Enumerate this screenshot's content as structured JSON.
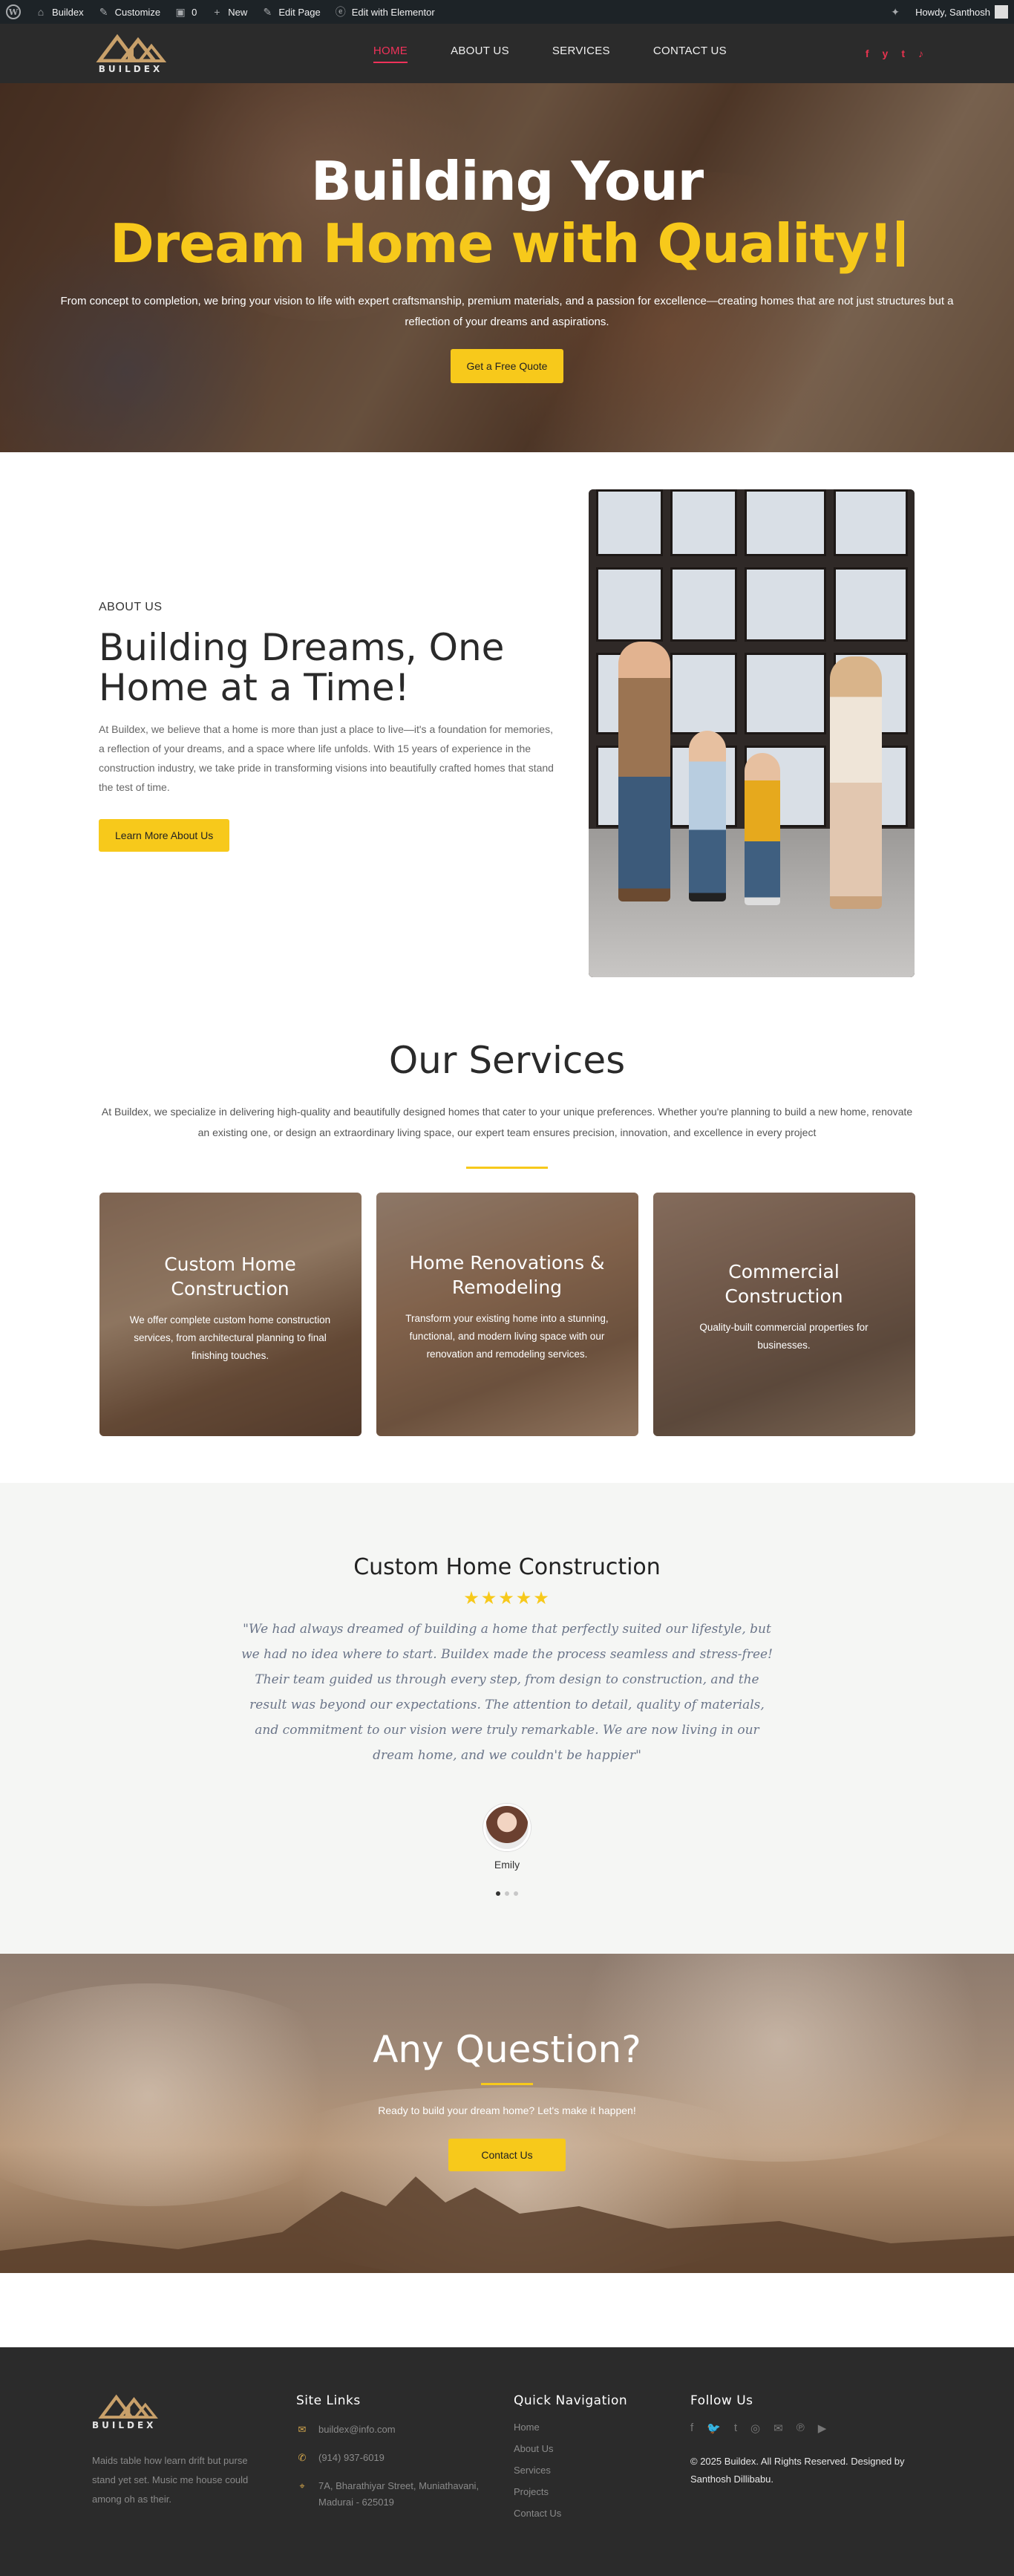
{
  "adminbar": {
    "site_name": "Buildex",
    "customize": "Customize",
    "comments": "0",
    "new": "New",
    "edit_page": "Edit Page",
    "elementor": "Edit with Elementor",
    "howdy": "Howdy, Santhosh"
  },
  "header": {
    "logo_text": "BUILDEX",
    "nav": [
      {
        "label": "HOME",
        "active": true
      },
      {
        "label": "ABOUT US"
      },
      {
        "label": "SERVICES"
      },
      {
        "label": "CONTACT US"
      }
    ],
    "socials": [
      {
        "icon": "facebook-icon",
        "glyph": "f"
      },
      {
        "icon": "twitter-icon",
        "glyph": "y"
      },
      {
        "icon": "tumblr-icon",
        "glyph": "t"
      },
      {
        "icon": "tiktok-icon",
        "glyph": "♪"
      }
    ],
    "accent_color": "#f0325a"
  },
  "hero": {
    "title_line1": "Building Your",
    "title_line2": "Dream Home with Quality!",
    "subtitle": "From concept to completion, we bring your vision to life with expert craftsmanship, premium materials, and a passion for excellence—creating homes that are not just structures but a reflection of your dreams and aspirations.",
    "cta": "Get a Free Quote",
    "accent_color": "#f7c91b"
  },
  "about": {
    "eyebrow": "ABOUT US",
    "title": "Building Dreams, One Home at a Time!",
    "body": "At Buildex, we believe that a home is more than just a place to live—it's a foundation for memories, a reflection of your dreams, and a space where life unfolds. With 15 years of experience in the construction industry, we take pride in transforming visions into beautifully crafted homes that stand the test of time.",
    "cta": "Learn More About Us"
  },
  "services": {
    "title": "Our Services",
    "intro": "At Buildex, we specialize in delivering high-quality and beautifully designed homes that cater to your unique preferences. Whether you're planning to build a new home, renovate an existing one, or design an extraordinary living space, our expert team ensures precision, innovation, and excellence in every project",
    "cards": [
      {
        "title": "Custom Home Construction",
        "text": "We offer complete custom home construction services, from architectural planning to final finishing touches."
      },
      {
        "title": "Home Renovations & Remodeling",
        "text": "Transform your existing home into a stunning, functional, and modern living space with our renovation and remodeling services."
      },
      {
        "title": "Commercial Construction",
        "text": "Quality-built commercial properties for businesses."
      }
    ]
  },
  "testimonial": {
    "title": "Custom Home Construction",
    "rating": "★★★★★",
    "rating_value": 4.5,
    "quote": "\"We had always dreamed of building a home that perfectly suited our lifestyle, but we had no idea where to start. Buildex made the process seamless and stress-free! Their team guided us through every step, from design to construction, and the result was beyond our expectations. The attention to detail, quality of materials, and commitment to our vision were truly remarkable. We are now living in our dream home, and we couldn't be happier\"",
    "name": "Emily",
    "slides": 3,
    "active_slide": 1
  },
  "cta": {
    "title": "Any Question?",
    "text": "Ready to build your dream home? Let's make it happen!",
    "button": "Contact Us"
  },
  "footer": {
    "logo_text": "BUILDEX",
    "about": "Maids table how learn drift but purse stand yet set. Music me house could among oh as their.",
    "site_links_title": "Site Links",
    "site_links": [
      {
        "icon": "envelope-icon",
        "glyph": "✉",
        "text": "buildex@info.com"
      },
      {
        "icon": "phone-icon",
        "glyph": "✆",
        "text": "(914) 937-6019"
      },
      {
        "icon": "map-pin-icon",
        "glyph": "⌖",
        "text": "7A, Bharathiyar Street, Muniathavani, Madurai - 625019"
      }
    ],
    "quick_nav_title": "Quick Navigation",
    "quick_nav": [
      "Home",
      "About Us",
      "Services",
      "Projects",
      "Contact Us"
    ],
    "follow_title": "Follow Us",
    "follow_icons": [
      {
        "icon": "facebook-icon",
        "glyph": "f"
      },
      {
        "icon": "twitter-icon",
        "glyph": "🐦"
      },
      {
        "icon": "tumblr-icon",
        "glyph": "t"
      },
      {
        "icon": "instagram-icon",
        "glyph": "◎"
      },
      {
        "icon": "mail-icon",
        "glyph": "✉"
      },
      {
        "icon": "pinterest-icon",
        "glyph": "℗"
      },
      {
        "icon": "youtube-icon",
        "glyph": "▶"
      }
    ],
    "copyright": "© 2025 Buildex. All Rights Reserved. Designed by Santhosh Dillibabu."
  }
}
